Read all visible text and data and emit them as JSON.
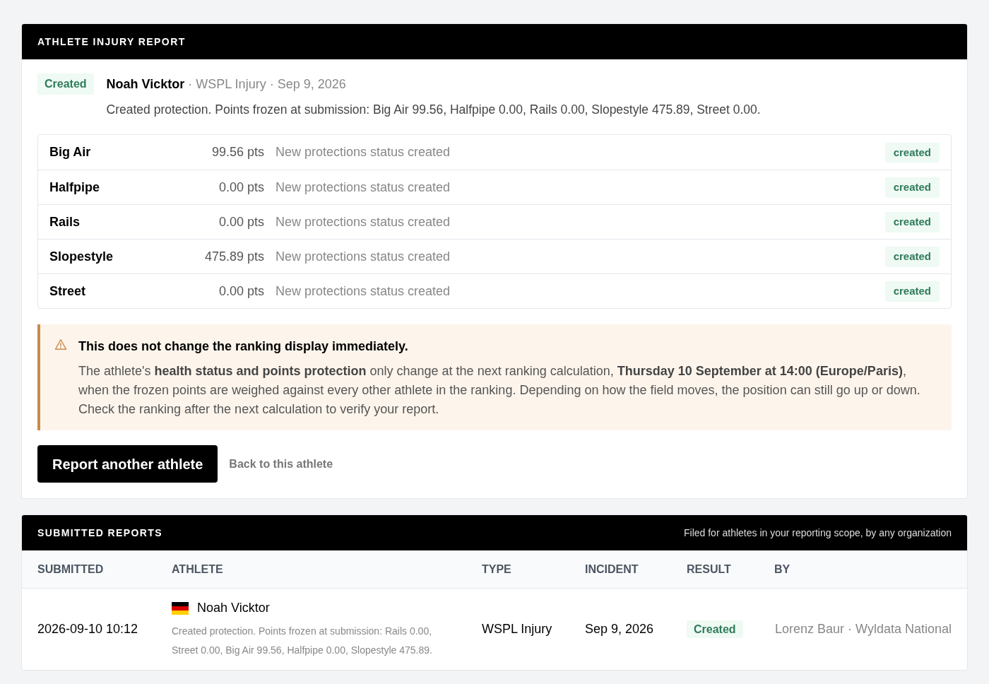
{
  "report": {
    "title": "ATHLETE INJURY REPORT",
    "badge": "Created",
    "athlete": "Noah Vicktor",
    "type": "· WSPL Injury",
    "date": "· Sep 9, 2026",
    "description": "Created protection. Points frozen at submission: Big Air 99.56, Halfpipe 0.00, Rails 0.00, Slopestyle 475.89, Street 0.00.",
    "protections": [
      {
        "discipline": "Big Air",
        "points": "99.56 pts",
        "note": "New protections status created",
        "status": "created"
      },
      {
        "discipline": "Halfpipe",
        "points": "0.00 pts",
        "note": "New protections status created",
        "status": "created"
      },
      {
        "discipline": "Rails",
        "points": "0.00 pts",
        "note": "New protections status created",
        "status": "created"
      },
      {
        "discipline": "Slopestyle",
        "points": "475.89 pts",
        "note": "New protections status created",
        "status": "created"
      },
      {
        "discipline": "Street",
        "points": "0.00 pts",
        "note": "New protections status created",
        "status": "created"
      }
    ],
    "notice": {
      "title": "This does not change the ranking display immediately.",
      "body": "The athlete's **health status and points protection** only change at the next ranking calculation, **Thursday 10 September at 14:00 (Europe/Paris)**, when the frozen points are weighed against every other athlete in the ranking. Depending on how the field moves, the position can still go up or down. Check the ranking after the next calculation to verify your report."
    },
    "primary_button": "Report another athlete",
    "secondary_link": "Back to this athlete"
  },
  "submitted_reports": {
    "title": "SUBMITTED REPORTS",
    "subtitle": "Filed for athletes in your reporting scope, by any organization",
    "columns": [
      "SUBMITTED",
      "ATHLETE",
      "TYPE",
      "INCIDENT",
      "RESULT",
      "BY"
    ],
    "rows": [
      {
        "submitted": "2026-09-10 10:12",
        "athlete": "Noah Vicktor",
        "summary": "Created protection. Points frozen at submission: Rails 0.00, Street 0.00, Big Air 99.56, Halfpipe 0.00, Slopestyle 475.89.",
        "type": "WSPL Injury",
        "incident": "Sep 9, 2026",
        "result": "Created",
        "by": "Lorenz Baur · Wyldata National"
      }
    ]
  }
}
